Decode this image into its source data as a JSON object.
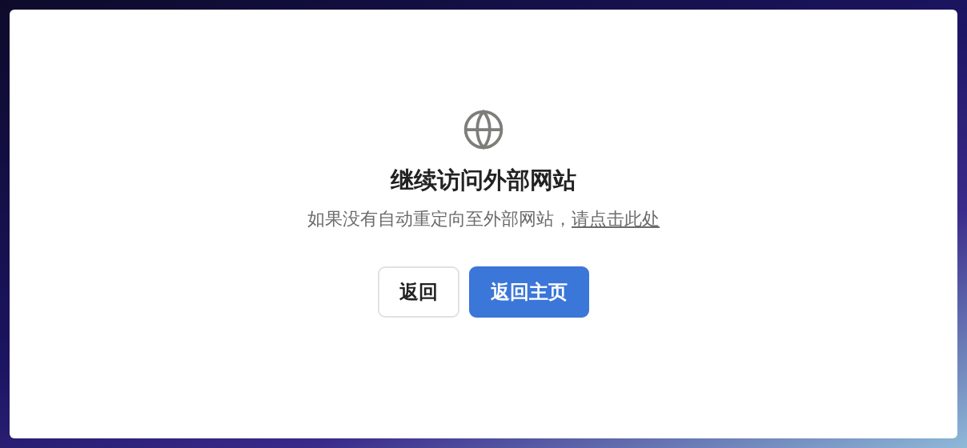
{
  "dialog": {
    "title": "继续访问外部网站",
    "message": "如果没有自动重定向至外部网站，",
    "link": "请点击此处",
    "buttons": [
      {
        "label": "返回",
        "kind": "secondary"
      },
      {
        "label": "返回主页",
        "kind": "primary"
      }
    ]
  }
}
